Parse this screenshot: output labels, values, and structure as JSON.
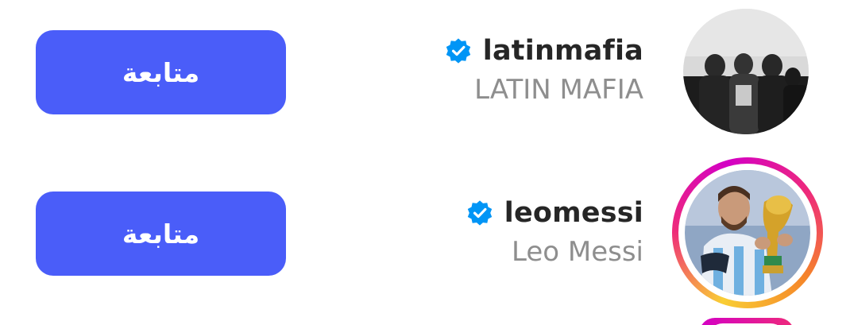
{
  "suggestions": [
    {
      "username": "latinmafia",
      "full_name": "LATIN MAFIA",
      "verified": true,
      "has_story": false,
      "follow_label": "متابعة"
    },
    {
      "username": "leomessi",
      "full_name": "Leo Messi",
      "verified": true,
      "has_story": true,
      "follow_label": "متابعة"
    }
  ],
  "colors": {
    "follow_button": "#4a5df9",
    "verified_badge": "#0095f6",
    "username_text": "#262626",
    "fullname_text": "#8e8e8e"
  },
  "icons": {
    "verified": "verified-badge-icon"
  }
}
